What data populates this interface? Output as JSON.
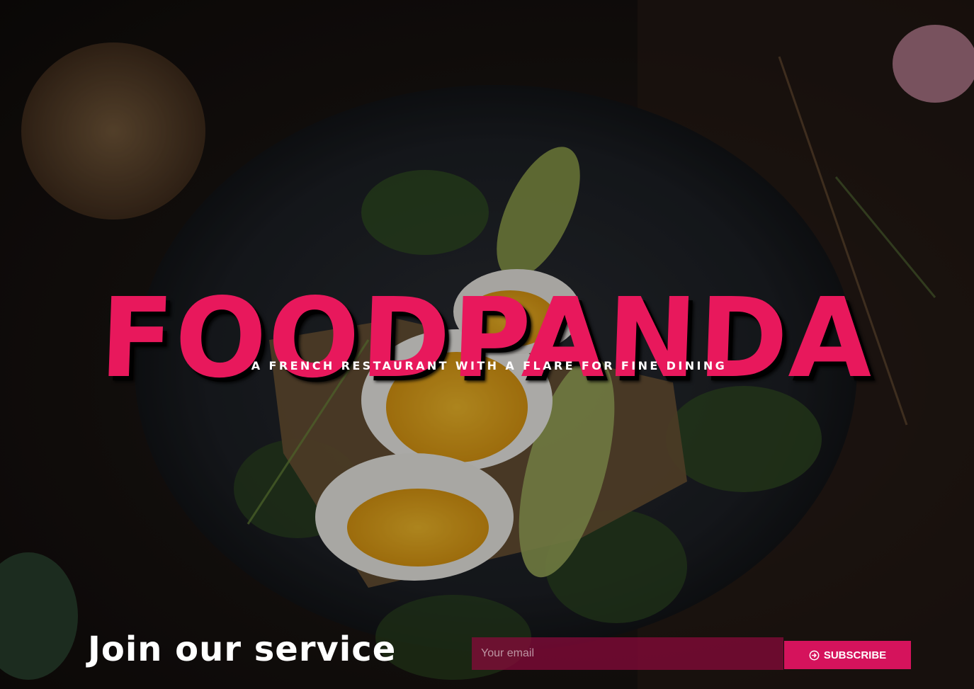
{
  "hero": {
    "title": "FOODPANDA",
    "tagline": "A FRENCH RESTAURANT WITH A FLARE FOR FINE DINING",
    "background_image": "food-photo-egg-toast-avocado"
  },
  "subscribe": {
    "heading": "Join our service",
    "email_placeholder": "Your email",
    "button_label": "SUBSCRIBE",
    "button_icon": "arrow-circle-right-icon"
  },
  "colors": {
    "brand": "#e8185c",
    "button": "#d5135c",
    "input_bg": "#8c0a3c"
  }
}
